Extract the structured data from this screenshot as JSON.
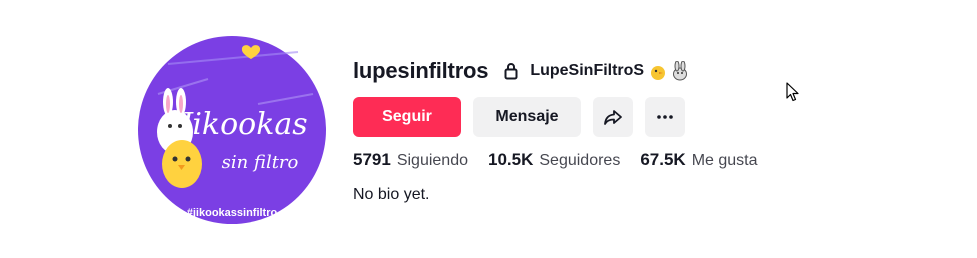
{
  "profile": {
    "username": "lupesinfiltros",
    "nickname": "LupeSinFiltroS",
    "avatar_icon": "profile-avatar-image",
    "avatar_text_main": "Jikookas",
    "avatar_text_sub": "sin filtro",
    "avatar_hashtag": "#jikookassinfiltro"
  },
  "buttons": {
    "follow_label": "Seguir",
    "message_label": "Mensaje",
    "share_icon": "share-icon",
    "more_icon": "more-icon"
  },
  "stats": {
    "following_count": "5791",
    "following_label": "Siguiendo",
    "followers_count": "10.5K",
    "followers_label": "Seguidores",
    "likes_count": "67.5K",
    "likes_label": "Me gusta"
  },
  "bio": "No bio yet.",
  "colors": {
    "primary": "#fe2c55",
    "secondary_button": "#f1f1f2",
    "avatar_bg": "#7b3fe4"
  }
}
